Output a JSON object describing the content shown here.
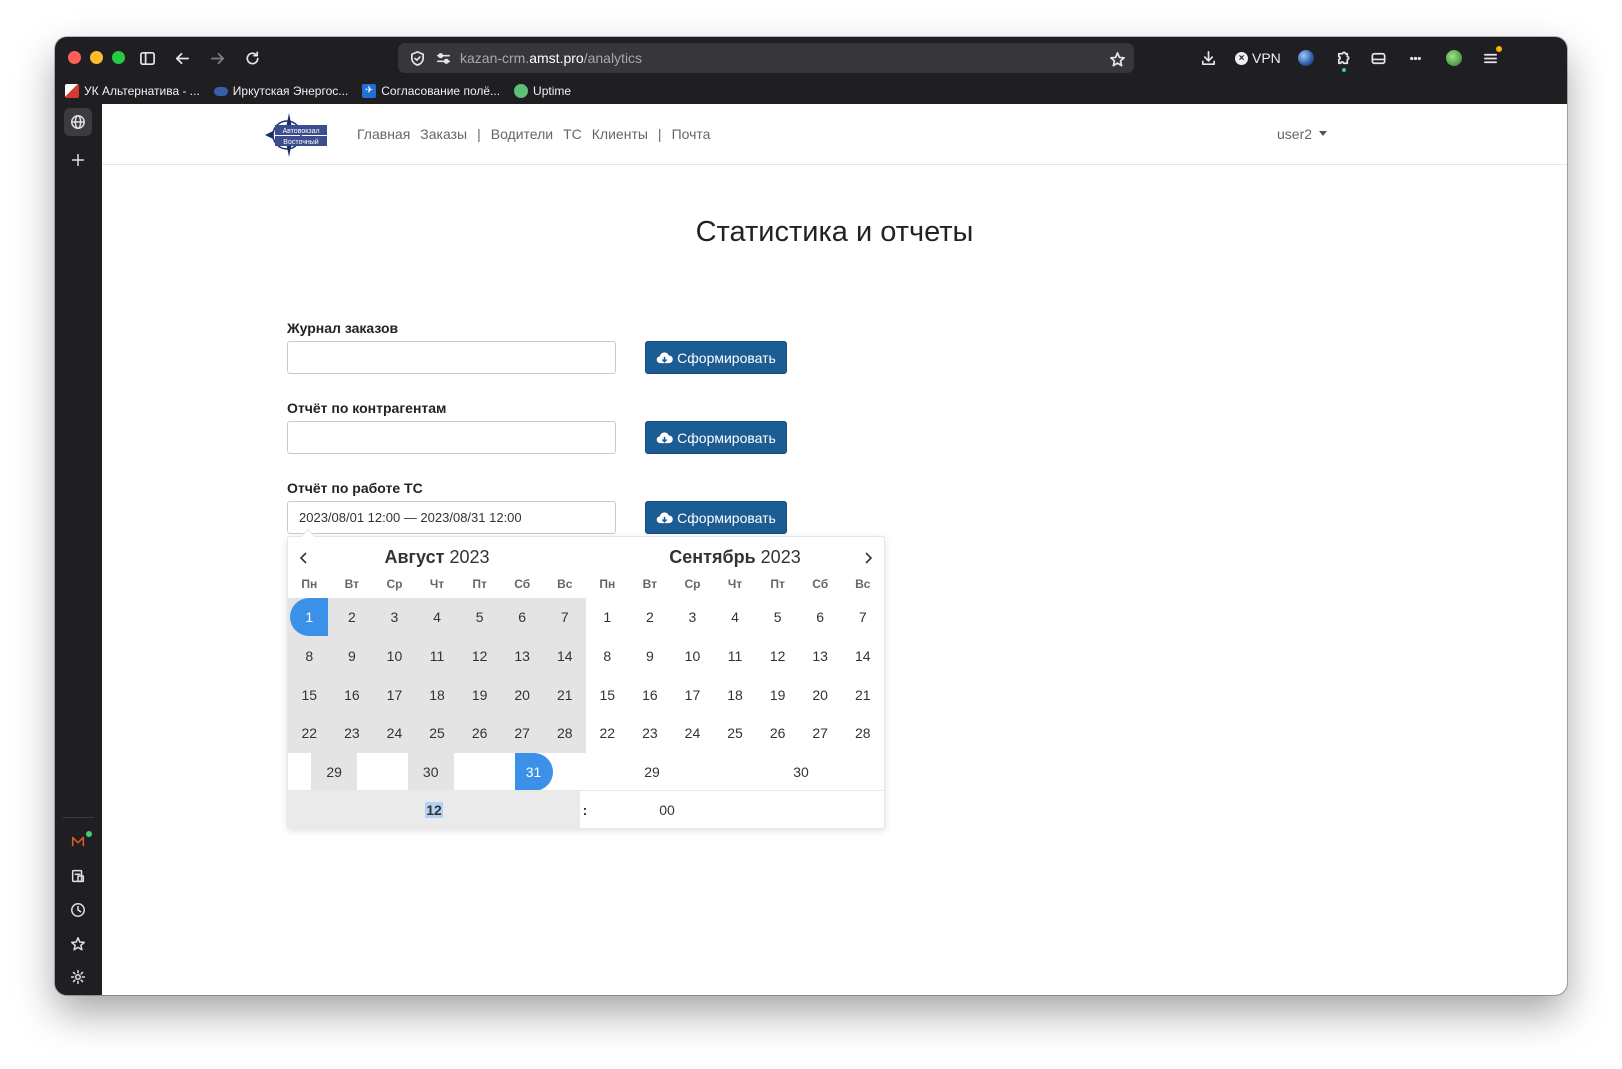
{
  "browser": {
    "url_prefix": "kazan-crm.",
    "url_domain": "amst.pro",
    "url_path": "/analytics",
    "vpn_label": "VPN"
  },
  "bookmarks": [
    {
      "label": "УК Альтернатива - ...",
      "icon": "uk-favicon"
    },
    {
      "label": "Иркутская Энергос...",
      "icon": "irk-favicon"
    },
    {
      "label": "Согласование полё...",
      "icon": "soglas-favicon"
    },
    {
      "label": "Uptime",
      "icon": "uptime-favicon"
    }
  ],
  "navbar": {
    "links": [
      "Главная",
      "Заказы",
      "|",
      "Водители",
      "ТС",
      "Клиенты",
      "|",
      "Почта"
    ],
    "user": "user2",
    "logo_text": [
      "Автовокзал",
      "Восточный"
    ]
  },
  "page": {
    "title": "Статистика и отчеты"
  },
  "reports": [
    {
      "label": "Журнал заказов",
      "value": "",
      "button": "Сформировать"
    },
    {
      "label": "Отчёт по контрагентам",
      "value": "",
      "button": "Сформировать"
    },
    {
      "label": "Отчёт по работе ТС",
      "value": "2023/08/01 12:00 — 2023/08/31 12:00",
      "button": "Сформировать"
    }
  ],
  "picker": {
    "weekdays": [
      "Пн",
      "Вт",
      "Ср",
      "Чт",
      "Пт",
      "Сб",
      "Вс"
    ],
    "left": {
      "month": "Август",
      "year": "2023",
      "weeks": [
        [
          "1",
          "2",
          "3",
          "4",
          "5",
          "6",
          "7"
        ],
        [
          "8",
          "9",
          "10",
          "11",
          "12",
          "13",
          "14"
        ],
        [
          "15",
          "16",
          "17",
          "18",
          "19",
          "20",
          "21"
        ],
        [
          "22",
          "23",
          "24",
          "25",
          "26",
          "27",
          "28"
        ],
        [
          "29",
          "30",
          "31"
        ]
      ]
    },
    "right": {
      "month": "Сентябрь",
      "year": "2023",
      "weeks": [
        [
          "1",
          "2",
          "3",
          "4",
          "5",
          "6",
          "7"
        ],
        [
          "8",
          "9",
          "10",
          "11",
          "12",
          "13",
          "14"
        ],
        [
          "15",
          "16",
          "17",
          "18",
          "19",
          "20",
          "21"
        ],
        [
          "22",
          "23",
          "24",
          "25",
          "26",
          "27",
          "28"
        ],
        [
          "29",
          "30"
        ]
      ]
    },
    "time": {
      "hour": "12",
      "separator": ":",
      "minute": "00"
    }
  },
  "colors": {
    "primary_button": "#1b5c93",
    "selected_day": "#3b91e8",
    "in_range": "#e4e4e4"
  }
}
